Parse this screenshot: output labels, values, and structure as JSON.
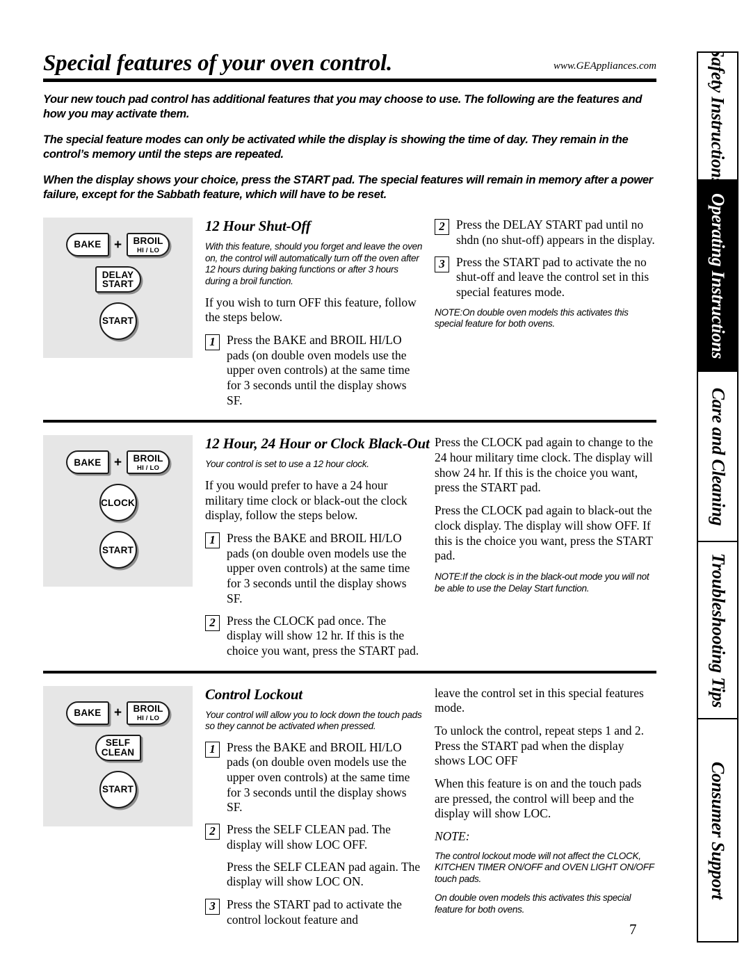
{
  "header": {
    "title": "Special features of your oven control.",
    "url": "www.GEAppliances.com"
  },
  "intro": {
    "p1": "Your new touch pad control has additional features that you may choose to use. The following are the features and how you may activate them.",
    "p2": "The special feature modes can only be activated while the display is showing the time of day. They remain in the control’s memory until the steps are repeated.",
    "p3": "When the display shows your choice, press the START pad. The special features will remain in memory after a power failure, except for the Sabbath feature, which will have to be reset."
  },
  "sections": [
    {
      "heading": "12 Hour Shut-Off",
      "pads": {
        "bake": "BAKE",
        "plus": "+",
        "broil": "BROIL",
        "broil_sub": "HI / LO",
        "second": "DELAY\nSTART",
        "second_line1": "DELAY",
        "second_line2": "START",
        "start": "START"
      },
      "left": {
        "lead_italic": "With this feature, should you forget and leave the oven on, the control will automatically turn off the oven after 12 hours during baking functions or after 3 hours during a broil function.",
        "para": "If you wish to turn OFF this feature, follow the steps below.",
        "step1_num": "1",
        "step1_text": "Press the BAKE and BROIL HI/LO pads (on double oven models use the upper oven controls) at the same time for 3 seconds until the display shows SF."
      },
      "right": {
        "step2_num": "2",
        "step2_text": "Press the DELAY START pad until no shdn (no shut-off) appears in the display.",
        "step3_num": "3",
        "step3_text": "Press the START pad to activate the no shut-off and leave the control set in this special features mode.",
        "note_label": "NOTE:",
        "note_text": "On double oven models this activates this special feature for both ovens."
      }
    },
    {
      "heading": "12 Hour, 24 Hour or Clock Black-Out",
      "pads": {
        "bake": "BAKE",
        "plus": "+",
        "broil": "BROIL",
        "broil_sub": "HI / LO",
        "second": "CLOCK",
        "start": "START"
      },
      "left": {
        "lead_italic": "Your control is set to use a 12 hour clock.",
        "para": "If you would prefer to have a 24 hour military time clock or black-out the clock display, follow the steps below.",
        "step1_num": "1",
        "step1_text": "Press the BAKE and BROIL HI/LO pads (on double oven models use the upper oven controls) at the same time for 3 seconds until the display shows SF.",
        "step2_num": "2",
        "step2_text": "Press the CLOCK pad once. The display will show 12 hr. If this is the choice you want, press the START pad."
      },
      "right": {
        "para1": "Press the CLOCK pad again to change to the 24 hour military time clock. The display will show 24 hr. If this is the choice you want, press the START pad.",
        "para2": "Press the CLOCK pad again to black-out the clock display. The display will show OFF. If this is the choice you want, press the START pad.",
        "note_label": "NOTE:",
        "note_text": "If the clock is in the black-out mode you will not be able to use the Delay Start function."
      }
    },
    {
      "heading": "Control Lockout",
      "pads": {
        "bake": "BAKE",
        "plus": "+",
        "broil": "BROIL",
        "broil_sub": "HI / LO",
        "second_line1": "SELF",
        "second_line2": "CLEAN",
        "start": "START"
      },
      "left": {
        "lead_italic": "Your control will allow you to lock down the touch pads so they cannot be activated when pressed.",
        "step1_num": "1",
        "step1_text": "Press the BAKE and BROIL HI/LO pads (on double oven models use the upper oven controls) at the same time for 3 seconds until the display shows SF.",
        "step2_num": "2",
        "step2_text": "Press the SELF CLEAN pad. The display will show LOC OFF.",
        "step2_cont": "Press the SELF CLEAN pad again. The display will show LOC ON.",
        "step3_num": "3",
        "step3_text": "Press the START pad to activate the control lockout feature and"
      },
      "right": {
        "para1": "leave the control set in this special features mode.",
        "para2": "To unlock the control, repeat steps 1 and 2. Press the START pad when the display shows LOC OFF",
        "para3": "When this feature is on and the touch pads are pressed, the control will beep and the display will show LOC.",
        "note_label": "NOTE:",
        "note1": "The control lockout mode will not affect the CLOCK, KITCHEN TIMER ON/OFF and OVEN LIGHT ON/OFF touch pads.",
        "note2": "On double oven models this activates this special feature for both ovens."
      }
    }
  ],
  "tabs": [
    {
      "label": "Safety Instructions",
      "active": false
    },
    {
      "label": "Operating Instructions",
      "active": true
    },
    {
      "label": "Care and Cleaning",
      "active": false
    },
    {
      "label": "Troubleshooting Tips",
      "active": false
    },
    {
      "label": "Consumer Support",
      "active": false
    }
  ],
  "page_number": "7"
}
